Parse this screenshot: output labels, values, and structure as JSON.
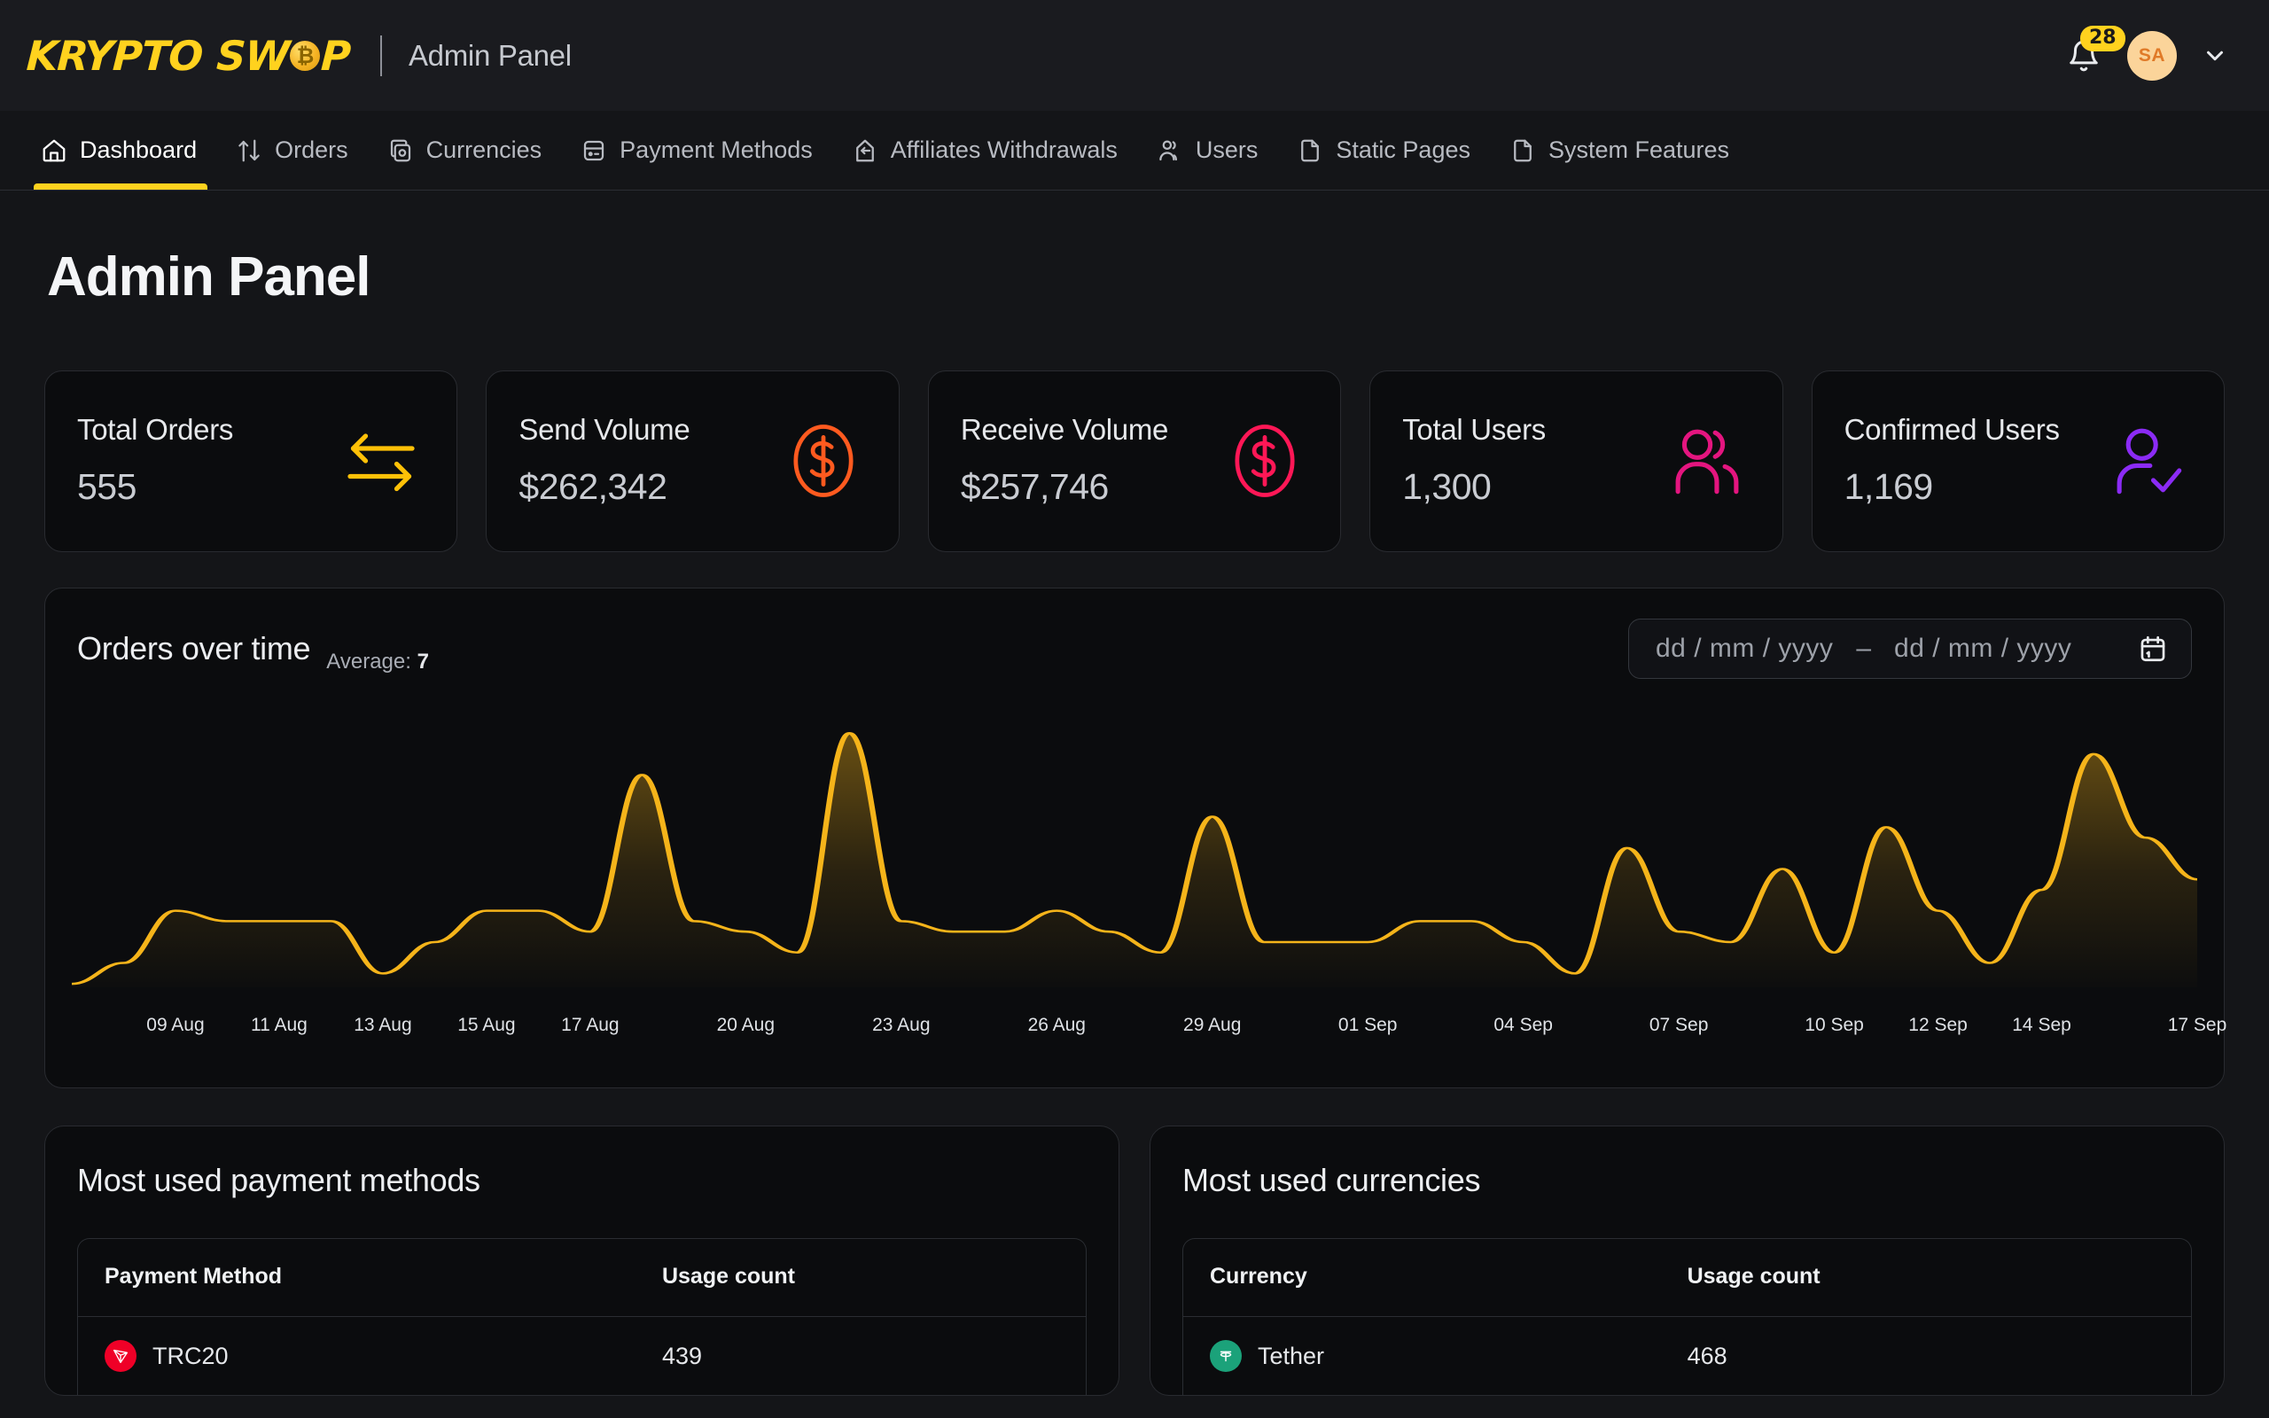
{
  "brand": {
    "logo_part1": "KRYPTO",
    "logo_part2_a": "SW",
    "logo_coin": "₿",
    "logo_part2_b": "P",
    "subtitle": "Admin Panel"
  },
  "topbar": {
    "notification_count": "28",
    "avatar_initials": "SA",
    "avatar_bg": "#FBD49A",
    "avatar_fg": "#E07A28",
    "badge_bg": "#FFD21E"
  },
  "nav": {
    "accent": "#FFD21E",
    "items": [
      {
        "label": "Dashboard",
        "icon": "home-icon",
        "active": true
      },
      {
        "label": "Orders",
        "icon": "arrows-updown-icon",
        "active": false
      },
      {
        "label": "Currencies",
        "icon": "coins-icon",
        "active": false
      },
      {
        "label": "Payment Methods",
        "icon": "credit-card-icon",
        "active": false
      },
      {
        "label": "Affiliates Withdrawals",
        "icon": "withdraw-icon",
        "active": false
      },
      {
        "label": "Users",
        "icon": "users-icon",
        "active": false
      },
      {
        "label": "Static Pages",
        "icon": "file-icon",
        "active": false
      },
      {
        "label": "System Features",
        "icon": "file-icon",
        "active": false
      }
    ]
  },
  "page": {
    "title": "Admin Panel"
  },
  "stats": [
    {
      "label": "Total Orders",
      "value": "555",
      "icon": "swap-arrows-icon",
      "color": "#FFC107"
    },
    {
      "label": "Send Volume",
      "value": "$262,342",
      "icon": "dollar-circle-icon",
      "color": "#FF5A1F"
    },
    {
      "label": "Receive Volume",
      "value": "$257,746",
      "icon": "dollar-circle-icon",
      "color": "#FF1756"
    },
    {
      "label": "Total Users",
      "value": "1,300",
      "icon": "users-icon",
      "color": "#E4157F"
    },
    {
      "label": "Confirmed Users",
      "value": "1,169",
      "icon": "user-check-icon",
      "color": "#8B2BF5"
    }
  ],
  "chart_card": {
    "title": "Orders over time",
    "average_label": "Average:",
    "average_value": "7",
    "date_from_placeholder": "dd / mm / yyyy",
    "date_to_placeholder": "dd / mm / yyyy",
    "date_separator": "–",
    "calendar_icon": "calendar-icon"
  },
  "chart_data": {
    "type": "area",
    "title": "Orders over time",
    "xlabel": "",
    "ylabel": "",
    "grid": false,
    "legend": "none",
    "line_color": "#F5B41A",
    "fill_gradient": [
      "rgba(245,180,26,0.42)",
      "rgba(245,180,26,0.0)"
    ],
    "ylim": [
      0,
      26
    ],
    "tick_labels": [
      "09 Aug",
      "11 Aug",
      "13 Aug",
      "15 Aug",
      "17 Aug",
      "20 Aug",
      "23 Aug",
      "26 Aug",
      "29 Aug",
      "01 Sep",
      "04 Sep",
      "07 Sep",
      "10 Sep",
      "12 Sep",
      "14 Sep",
      "17 Sep"
    ],
    "tick_positions_pct": [
      3.3,
      6.3,
      9.2,
      12.1,
      15.0,
      19.3,
      23.6,
      27.9,
      32.2,
      36.5,
      40.9,
      45.2,
      49.5,
      53.8,
      58.1,
      62.4
    ],
    "x": [
      "07 Aug",
      "08 Aug",
      "09 Aug",
      "10 Aug",
      "11 Aug",
      "12 Aug",
      "13 Aug",
      "14 Aug",
      "15 Aug",
      "16 Aug",
      "17 Aug",
      "18 Aug",
      "19 Aug",
      "20 Aug",
      "21 Aug",
      "22 Aug",
      "23 Aug",
      "24 Aug",
      "25 Aug",
      "26 Aug",
      "27 Aug",
      "28 Aug",
      "29 Aug",
      "30 Aug",
      "31 Aug",
      "01 Sep",
      "02 Sep",
      "03 Sep",
      "04 Sep",
      "05 Sep",
      "06 Sep",
      "07 Sep",
      "08 Sep",
      "09 Sep",
      "10 Sep",
      "11 Sep",
      "12 Sep",
      "13 Sep",
      "14 Sep",
      "15 Sep",
      "16 Sep",
      "17 Sep"
    ],
    "values": [
      0,
      2,
      7,
      6,
      6,
      6,
      1,
      4,
      7,
      7,
      5,
      20,
      6,
      5,
      3,
      24,
      6,
      5,
      5,
      7,
      5,
      3,
      16,
      4,
      4,
      4,
      6,
      6,
      4,
      1,
      13,
      5,
      4,
      11,
      3,
      15,
      7,
      2,
      9,
      22,
      14,
      10
    ]
  },
  "payment_panel": {
    "title": "Most used payment methods",
    "columns": [
      "Payment Method",
      "Usage count"
    ],
    "rows": [
      {
        "name": "TRC20",
        "count": "439",
        "icon": "tron-icon",
        "icon_bg": "#EF0027",
        "icon_fg": "#ffffff"
      }
    ]
  },
  "currency_panel": {
    "title": "Most used currencies",
    "columns": [
      "Currency",
      "Usage count"
    ],
    "rows": [
      {
        "name": "Tether",
        "count": "468",
        "icon": "tether-icon",
        "icon_bg": "#1BA27A",
        "icon_fg": "#ffffff"
      }
    ]
  }
}
